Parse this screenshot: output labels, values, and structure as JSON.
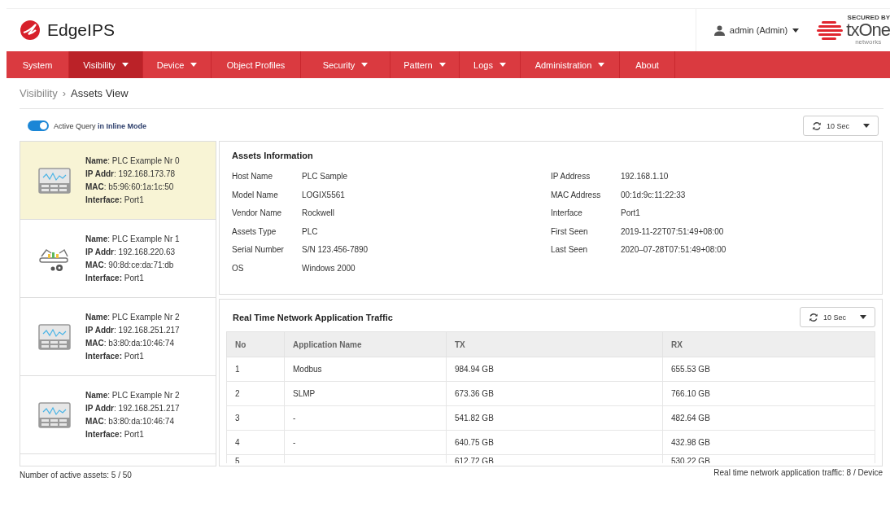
{
  "header": {
    "app_name": "EdgeIPS",
    "user": "admin (Admin)",
    "brand_tagline": "SECURED BY",
    "brand_name": "txOne",
    "brand_sub": "networks"
  },
  "nav": [
    {
      "label": "System",
      "selected": false,
      "dropdown": false
    },
    {
      "label": "Visibility",
      "selected": true,
      "dropdown": true
    },
    {
      "label": "Device",
      "selected": false,
      "dropdown": true
    },
    {
      "label": "Object Profiles",
      "selected": false,
      "dropdown": false
    },
    {
      "label": "Security",
      "selected": false,
      "dropdown": true
    },
    {
      "label": "Pattern",
      "selected": false,
      "dropdown": true
    },
    {
      "label": "Logs",
      "selected": false,
      "dropdown": true
    },
    {
      "label": "Administration",
      "selected": false,
      "dropdown": true
    },
    {
      "label": "About",
      "selected": false,
      "dropdown": false
    }
  ],
  "breadcrumb": [
    "Visibility",
    "Assets View"
  ],
  "breadcrumb_separator": "›",
  "active_query": {
    "on": true,
    "label": "Active Query **in Inline Mode**"
  },
  "refresh": {
    "value": "10 Sec"
  },
  "assets": [
    {
      "kind": "monitor",
      "selected": true,
      "lines": [
        "**Name**: PLC Example Nr 0",
        "**IP Addr**: 192.168.173.78",
        "**MAC**: b5:96:60:1a:1c:50",
        "**Interface:** Port1"
      ]
    },
    {
      "kind": "robot",
      "selected": false,
      "lines": [
        "**Name**: PLC Example Nr 1",
        "**IP Addr**: 192.168.220.63",
        "**MAC**: 90:8d:ce:da:71:db",
        "**Interface:** Port1"
      ]
    },
    {
      "kind": "monitor",
      "selected": false,
      "lines": [
        "**Name**: PLC Example Nr 2",
        "**IP Addr**: 192.168.251.217",
        "**MAC**: b3:80:da:10:46:74",
        "**Interface:** Port1"
      ]
    },
    {
      "kind": "monitor",
      "selected": false,
      "lines": [
        "**Name**: PLC Example Nr 2",
        "**IP Addr**: 192.168.251.217",
        "**MAC**: b3:80:da:10:46:74",
        "**Interface:** Port1"
      ]
    }
  ],
  "assets_count": "Number of active assets: 5 / 50",
  "assets_info": {
    "title": "Assets Information",
    "left": [
      {
        "label": "Host Name",
        "value": "PLC Sample"
      },
      {
        "label": "Model Name",
        "value": "LOGIX5561"
      },
      {
        "label": "Vendor Name",
        "value": "Rockwell"
      },
      {
        "label": "Assets Type",
        "value": "PLC"
      },
      {
        "label": "Serial Number",
        "value": "S/N 123.456-7890"
      },
      {
        "label": "OS",
        "value": "Windows 2000"
      }
    ],
    "right": [
      {
        "label": "IP Address",
        "value": "192.168.1.10"
      },
      {
        "label": "MAC Address",
        "value": "00:1d:9c:11:22:33"
      },
      {
        "label": "Interface",
        "value": "Port1"
      },
      {
        "label": "First Seen",
        "value": "2019-11-22T07:51:49+08:00"
      },
      {
        "label": "Last Seen",
        "value": "2020–07-28T07:51:49+08:00"
      }
    ]
  },
  "traffic": {
    "title": "Real Time Network Application Traffic",
    "refresh": "10 Sec",
    "columns": [
      "No",
      "Application Name",
      "TX",
      "RX"
    ],
    "rows": [
      [
        "1",
        "Modbus",
        "984.94 GB",
        "655.53 GB"
      ],
      [
        "2",
        "SLMP",
        "673.36 GB",
        "766.10 GB"
      ],
      [
        "3",
        "-",
        "541.82 GB",
        "482.64 GB"
      ],
      [
        "4",
        "-",
        "640.75 GB",
        "432.98 GB"
      ],
      [
        "5",
        "",
        "612.72 GB",
        "530.22 GB"
      ]
    ],
    "footer": "Real time network application traffic: 8 / Device"
  }
}
